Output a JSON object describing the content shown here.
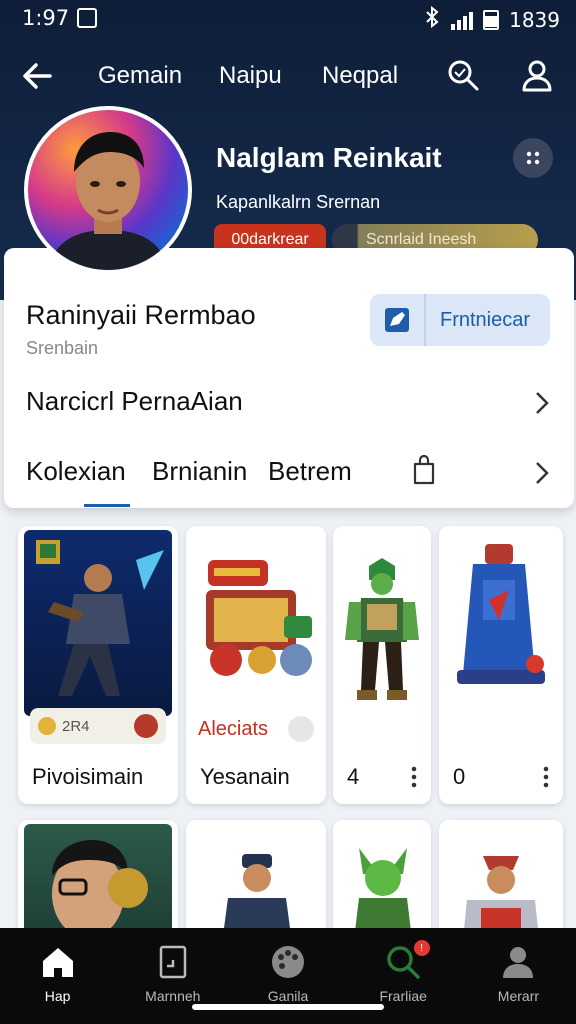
{
  "status_bar": {
    "time": "1:97",
    "right_value": "1839"
  },
  "top_nav": {
    "tabs": [
      "Gemain",
      "Naipu",
      "Neqpal"
    ]
  },
  "profile": {
    "name": "Nalglam Reinkait",
    "subtitle": "Kapanlkalrn Srernan",
    "badge_primary": "00darkrear",
    "badge_secondary": "Scnrlaid Ineesh"
  },
  "card": {
    "title": "Raninyaii Rermbao",
    "subtitle": "Srenbain",
    "action_button": "Frntniecar",
    "row_label": "Narcicrl PernaAian",
    "tabs": [
      "Kolexian",
      "Brnianin",
      "Betrem"
    ]
  },
  "grid": {
    "tiles": [
      {
        "label": "Pivoisimain",
        "chip_value": "2R4"
      },
      {
        "label": "Yesanain",
        "overlay_text": "Aleciats"
      },
      {
        "label": "4"
      },
      {
        "label": "0"
      }
    ]
  },
  "bottom_nav": {
    "items": [
      {
        "label": "Hap"
      },
      {
        "label": "Marnneh"
      },
      {
        "label": "Ganila"
      },
      {
        "label": "Frarliae",
        "badge": "!"
      },
      {
        "label": "Merarr"
      }
    ]
  },
  "colors": {
    "header_bg": "#0e1e38",
    "accent": "#1c5ea8",
    "badge_red": "#c8331e"
  }
}
